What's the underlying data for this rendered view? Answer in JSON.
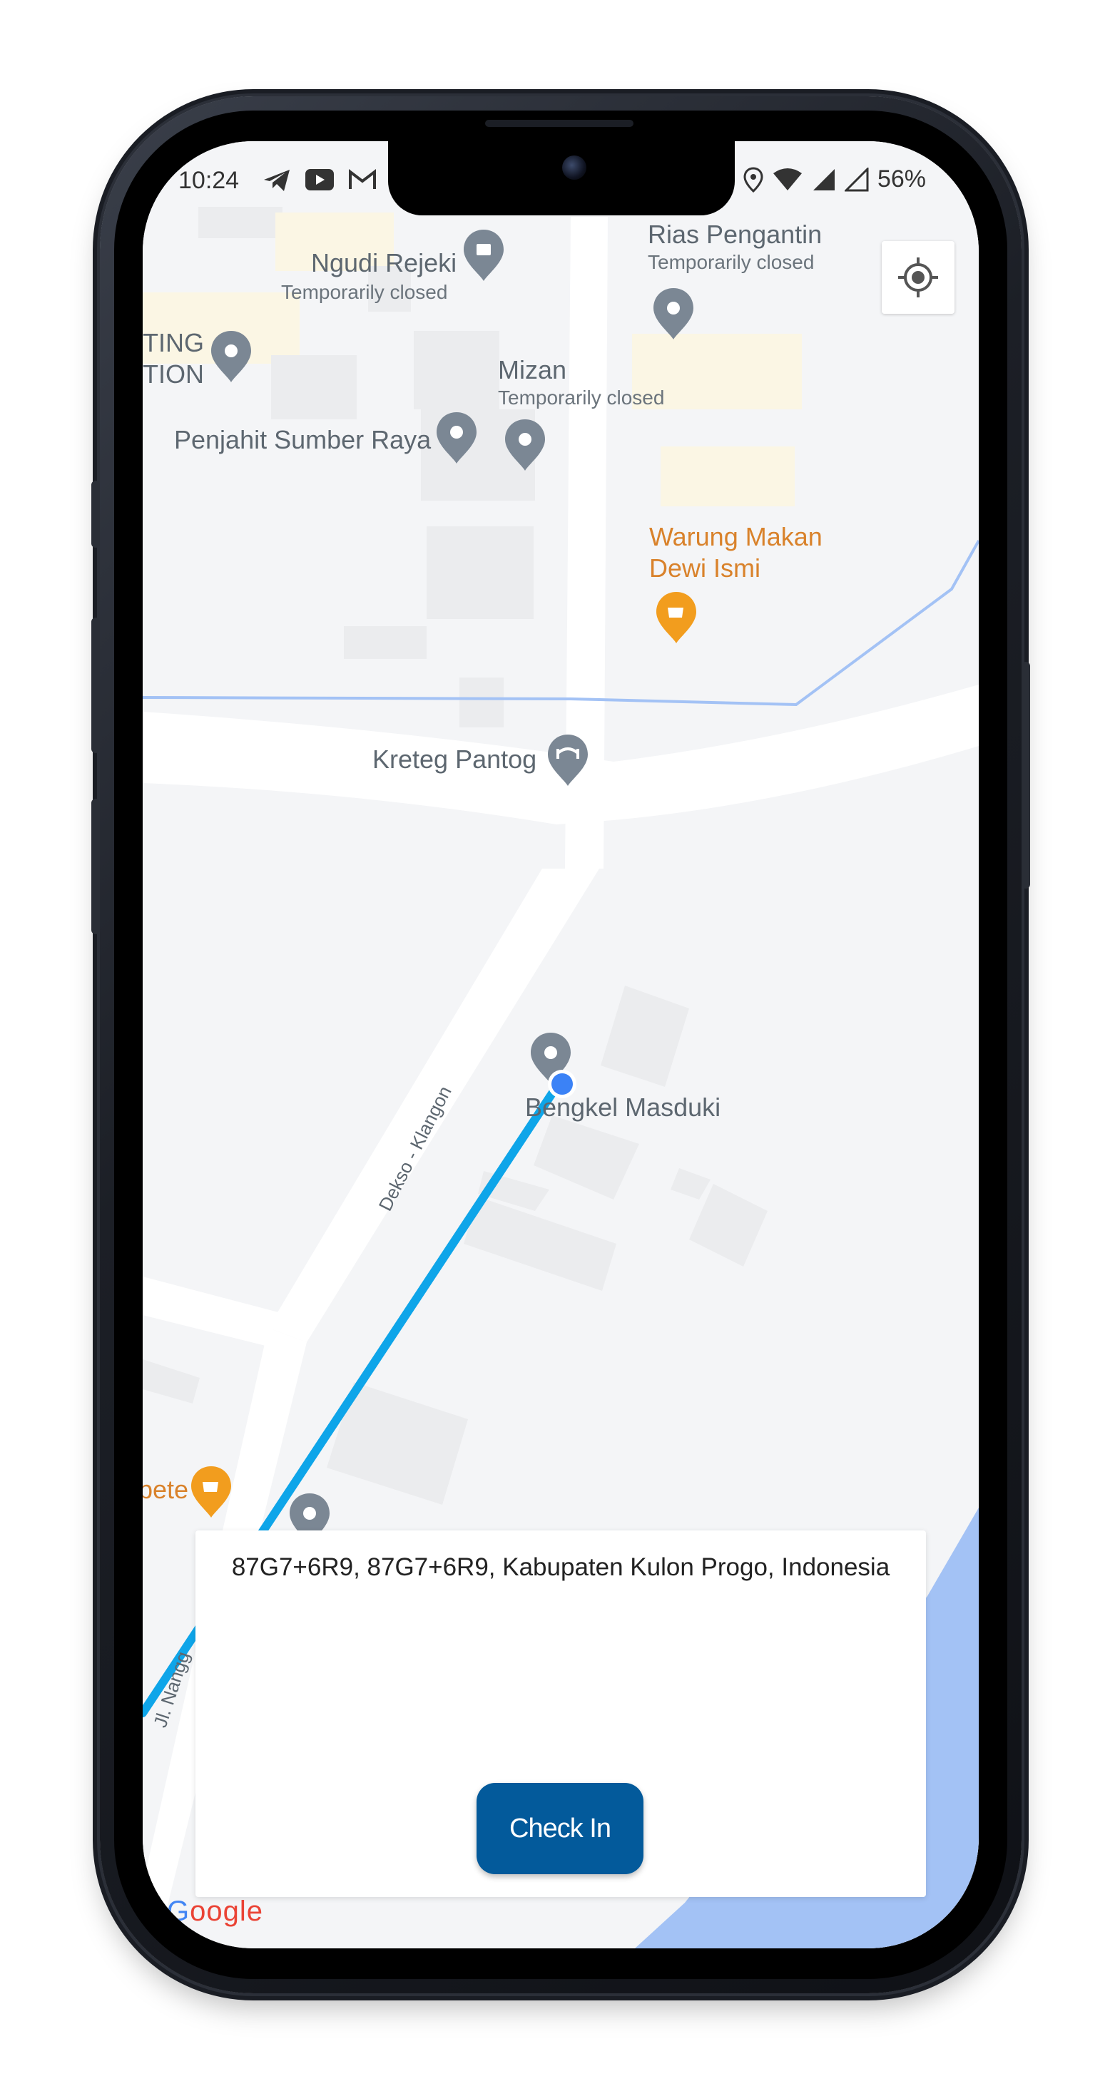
{
  "status_bar": {
    "time": "10:24",
    "battery": "56%",
    "left_icons": [
      "telegram-icon",
      "youtube-icon",
      "gmail-icon"
    ],
    "right_icons": [
      "location-icon",
      "wifi-icon",
      "signal-icon",
      "signal-empty-icon"
    ]
  },
  "map": {
    "pois": {
      "ngudi_rejeki": {
        "name": "Ngudi Rejeki",
        "status": "Temporarily closed"
      },
      "rias_pengantin": {
        "name": "Rias Pengantin",
        "status": "Temporarily closed"
      },
      "mizan": {
        "name": "Mizan",
        "status": "Temporarily closed"
      },
      "penjahit": {
        "name": "Penjahit Sumber Raya"
      },
      "warung_line1": "Warung Makan",
      "warung_line2": "Dewi Ismi",
      "kreteg": {
        "name": "Kreteg Pantog"
      },
      "bengkel": {
        "name": "Bengkel Masduki"
      },
      "partial_left_1": "TING",
      "partial_left_2": "TION",
      "partial_bottom": "pete"
    },
    "roads": {
      "dekso": "Dekso - Klangon",
      "nanggulan": "Jl. Nangg"
    },
    "colors": {
      "route": "#0ea5e9",
      "user_location": "#3b82f6",
      "water": "#a3c2f5",
      "food_pin": "#f29d1e",
      "pin": "#7b8794"
    }
  },
  "card": {
    "address": "87G7+6R9, 87G7+6R9, Kabupaten Kulon Progo, Indonesia",
    "button_label": "Check In",
    "button_color": "#035a9b"
  },
  "attribution": {
    "g": "G",
    "rest": "oogle"
  }
}
